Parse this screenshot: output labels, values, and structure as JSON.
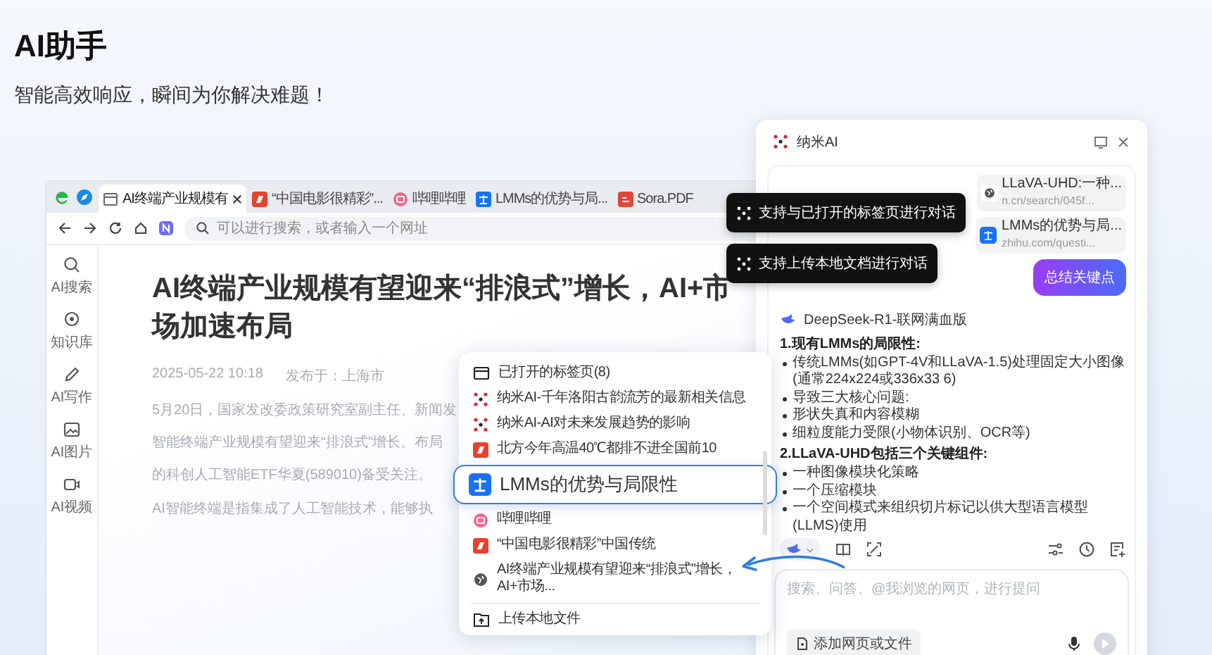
{
  "hero": {
    "title": "AI助手",
    "subtitle": "智能高效响应，瞬间为你解决难题！"
  },
  "browser": {
    "tabs": [
      {
        "label": "AI终端产业规模有",
        "kind": "page",
        "selected": true
      },
      {
        "label": "“中国电影很精彩”...",
        "kind": "kr",
        "selected": false
      },
      {
        "label": "哔哩哔哩",
        "kind": "bili",
        "selected": false
      },
      {
        "label": "LMMs的优势与局...",
        "kind": "zhihu",
        "selected": false
      },
      {
        "label": "Sora.PDF",
        "kind": "pdf",
        "selected": false
      }
    ],
    "address_placeholder": "可以进行搜索，或者输入一个网址",
    "sidebar": [
      {
        "label": "AI搜索",
        "kind": "search"
      },
      {
        "label": "知识库",
        "kind": "pin"
      },
      {
        "label": "AI写作",
        "kind": "pen"
      },
      {
        "label": "AI图片",
        "kind": "image"
      },
      {
        "label": "AI视频",
        "kind": "video"
      }
    ],
    "article": {
      "title": "AI终端产业规模有望迎来“排浪式”增长，AI+市场加速布局",
      "date": "2025-05-22 10:18",
      "location": "发布于：上海市",
      "paragraphs": [
        [
          "5月20日，国家发改委政策研究室副主任、新闻发",
          "智能终端产业规模有望迎来“排浪式”增长。布局",
          "的科创人工智能ETF华夏(589010)备受关注。"
        ],
        [
          "AI智能终端是指集成了人工智能技术，能够执"
        ]
      ]
    }
  },
  "popup": {
    "header": "已打开的标签页(8)",
    "items": [
      {
        "label": "纳米AI-千年洛阳古韵流芳的最新相关信息",
        "kind": "nami",
        "selected": false
      },
      {
        "label": "纳米AI-AI对未来发展趋势的影响",
        "kind": "nami",
        "selected": false
      },
      {
        "label": "北方今年高温40℃都排不进全国前10",
        "kind": "kr",
        "selected": false
      },
      {
        "label": "LMMs的优势与局限性",
        "kind": "zhihu",
        "selected": true
      },
      {
        "label": "哔哩哔哩",
        "kind": "bili",
        "selected": false
      },
      {
        "label": "“中国电影很精彩”中国传统",
        "kind": "kr",
        "selected": false
      },
      {
        "label": "AI终端产业规模有望迎来“排浪式”增长，AI+市场...",
        "kind": "globe",
        "selected": false
      }
    ],
    "footer": "上传本地文件"
  },
  "tooltips": [
    "支持与已打开的标签页进行对话",
    "支持上传本地文档进行对话"
  ],
  "panel": {
    "title": "纳米AI",
    "sources": [
      {
        "title": "LLaVA-UHD:一种...",
        "url": "n.cn/search/045f...",
        "kind": "globe"
      },
      {
        "title": "LMMs的优势与局...",
        "url": "zhihu.com/questi...",
        "kind": "zhihu"
      }
    ],
    "user_message": "总结关键点",
    "model": "DeepSeek-R1-联网满血版",
    "sections": [
      {
        "heading": "1.现有LMMs的局限性:",
        "bullets": [
          "传统LMMs(如GPT-4V和LLaVA-1.5)处理固定大小图像(通常224x224或336x33 6)",
          "导致三大核心问题:",
          "形状失真和内容模糊",
          "细粒度能力受限(小物体识别、OCR等)"
        ]
      },
      {
        "heading": "2.LLaVA-UHD包括三个关键组件:",
        "bullets": [
          "一种图像模块化策略",
          "一个压缩模块",
          "一个空间模式来组织切片标记以供大型语言模型(LLMS)使用"
        ]
      }
    ],
    "placeholder": "搜索、问答、@我浏览的网页，进行提问",
    "attach": "添加网页或文件"
  }
}
